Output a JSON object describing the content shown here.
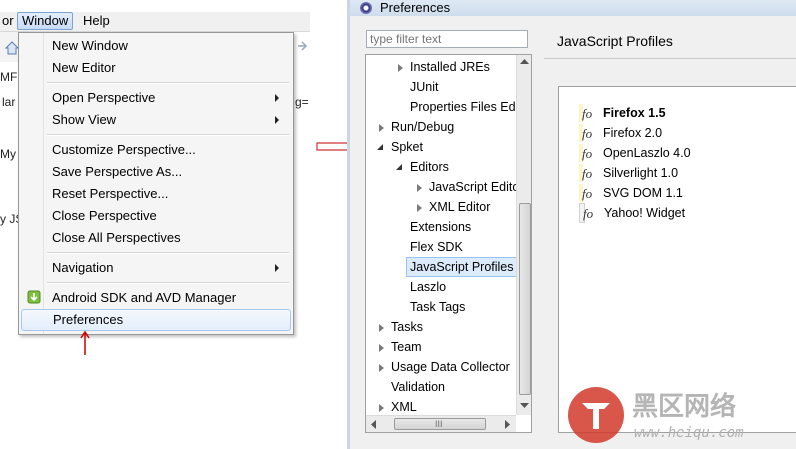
{
  "left": {
    "menubar": {
      "partial": "or",
      "window": "Window",
      "help": "Help"
    },
    "bg": {
      "t1": "MF",
      "t2": "lar",
      "t3": "My",
      "t4": "y JS",
      "t5": "g="
    },
    "menu": [
      {
        "label": "New Window"
      },
      {
        "label": "New Editor"
      },
      {
        "label": "Open Perspective"
      },
      {
        "label": "Show View"
      },
      {
        "label": "Customize Perspective..."
      },
      {
        "label": "Save Perspective As..."
      },
      {
        "label": "Reset Perspective..."
      },
      {
        "label": "Close Perspective"
      },
      {
        "label": "Close All Perspectives"
      },
      {
        "label": "Navigation"
      },
      {
        "label": "Android SDK and AVD Manager"
      },
      {
        "label": "Preferences"
      }
    ],
    "arrow_color": "#cc0000"
  },
  "dialog": {
    "title": "Preferences",
    "filter_placeholder": "type filter text",
    "page_title": "JavaScript Profiles",
    "tree": [
      {
        "label": "Installed JREs"
      },
      {
        "label": "JUnit"
      },
      {
        "label": "Properties Files Ed"
      },
      {
        "label": "Run/Debug"
      },
      {
        "label": "Spket"
      },
      {
        "label": "Editors"
      },
      {
        "label": "JavaScript Edito"
      },
      {
        "label": "XML Editor"
      },
      {
        "label": "Extensions"
      },
      {
        "label": "Flex SDK"
      },
      {
        "label": "JavaScript Profiles"
      },
      {
        "label": "Laszlo"
      },
      {
        "label": "Task Tags"
      },
      {
        "label": "Tasks"
      },
      {
        "label": "Team"
      },
      {
        "label": "Usage Data Collector"
      },
      {
        "label": "Validation"
      },
      {
        "label": "XML"
      }
    ],
    "scroll_grip": "III",
    "profiles": [
      {
        "icon": "fo",
        "label": "Firefox 1.5",
        "bold": true
      },
      {
        "icon": "fo",
        "label": "Firefox 2.0"
      },
      {
        "icon": "fo",
        "label": "OpenLaszlo 4.0"
      },
      {
        "icon": "fo",
        "label": "Silverlight 1.0"
      },
      {
        "icon": "fo",
        "label": "SVG DOM 1.1"
      },
      {
        "icon": "fo",
        "label": "Yahoo! Widget"
      }
    ]
  },
  "watermark": {
    "cn": "黑区网络",
    "url": "www.heiqu.com"
  },
  "colors": {
    "accent": "#3399ff",
    "arrow": "#cc0000",
    "selection": "#dcebfc"
  }
}
